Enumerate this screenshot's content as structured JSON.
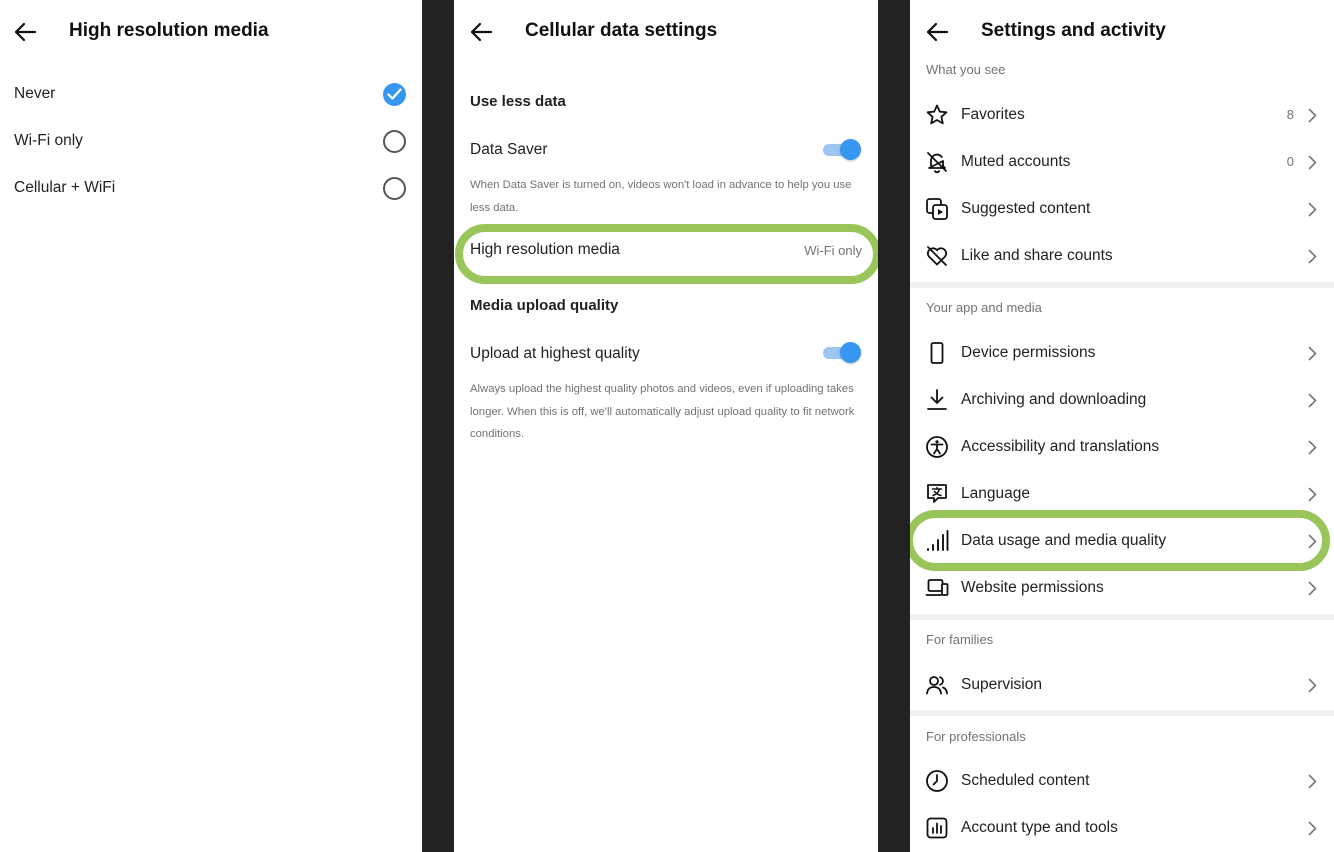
{
  "panel1": {
    "title": "High resolution media",
    "options": [
      {
        "label": "Never",
        "selected": true
      },
      {
        "label": "Wi-Fi only",
        "selected": false
      },
      {
        "label": "Cellular + WiFi",
        "selected": false
      }
    ]
  },
  "panel2": {
    "title": "Cellular data settings",
    "use_less_data_heading": "Use less data",
    "data_saver": {
      "label": "Data Saver",
      "enabled": true,
      "description": "When Data Saver is turned on, videos won't load in advance to help you use less data."
    },
    "high_res": {
      "label": "High resolution media",
      "value": "Wi-Fi only"
    },
    "upload_heading": "Media upload quality",
    "upload": {
      "label": "Upload at highest quality",
      "enabled": true,
      "description": "Always upload the highest quality photos and videos, even if uploading takes longer. When this is off, we'll automatically adjust upload quality to fit network conditions."
    }
  },
  "panel3": {
    "title": "Settings and activity",
    "groups": [
      {
        "heading": "What you see",
        "items": [
          {
            "label": "Favorites",
            "count": "8",
            "icon": "star-icon"
          },
          {
            "label": "Muted accounts",
            "count": "0",
            "icon": "bell-off-icon"
          },
          {
            "label": "Suggested content",
            "icon": "suggested-content-icon"
          },
          {
            "label": "Like and share counts",
            "icon": "heart-off-icon"
          }
        ]
      },
      {
        "heading": "Your app and media",
        "items": [
          {
            "label": "Device permissions",
            "icon": "phone-icon"
          },
          {
            "label": "Archiving and downloading",
            "icon": "download-icon"
          },
          {
            "label": "Accessibility and translations",
            "icon": "accessibility-icon"
          },
          {
            "label": "Language",
            "icon": "language-icon"
          },
          {
            "label": "Data usage and media quality",
            "icon": "signal-icon"
          },
          {
            "label": "Website permissions",
            "icon": "laptop-icon"
          }
        ]
      },
      {
        "heading": "For families",
        "items": [
          {
            "label": "Supervision",
            "icon": "people-icon"
          }
        ]
      },
      {
        "heading": "For professionals",
        "items": [
          {
            "label": "Scheduled content",
            "icon": "clock-icon"
          },
          {
            "label": "Account type and tools",
            "icon": "chart-icon"
          }
        ]
      }
    ]
  },
  "colors": {
    "accent_blue": "#3797f0",
    "highlight_green": "#99c55a",
    "panel_gap": "#222222",
    "secondary_text": "#737373"
  }
}
